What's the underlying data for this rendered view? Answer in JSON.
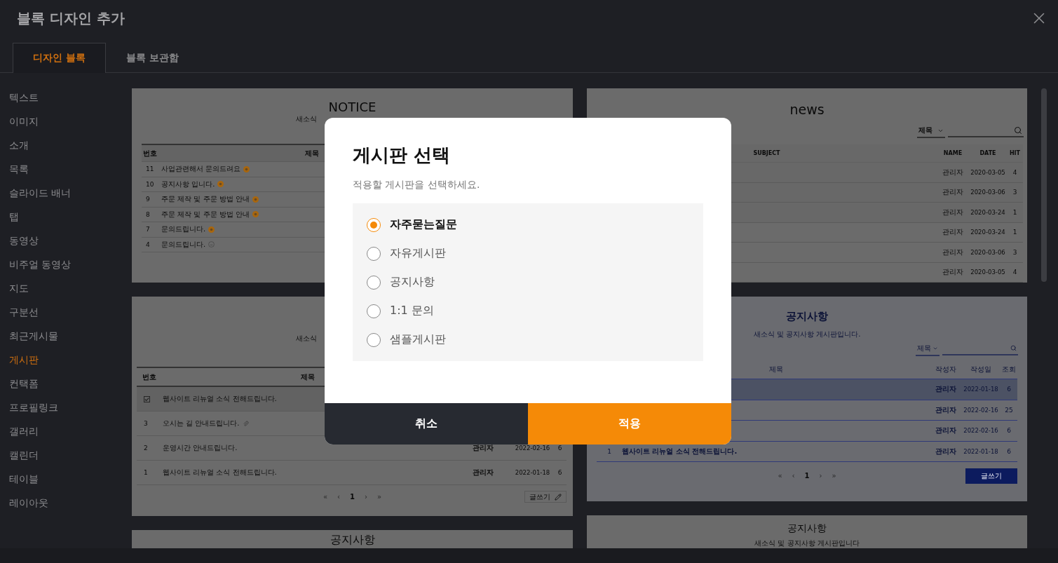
{
  "window": {
    "title": "블록 디자인 추가"
  },
  "tabs": [
    {
      "label": "디자인 블록",
      "selected": true
    },
    {
      "label": "블록 보관함",
      "selected": false
    }
  ],
  "sidebar": {
    "items": [
      {
        "label": "텍스트",
        "selected": false
      },
      {
        "label": "이미지",
        "selected": false
      },
      {
        "label": "소개",
        "selected": false
      },
      {
        "label": "목록",
        "selected": false
      },
      {
        "label": "슬라이드 배너",
        "selected": false
      },
      {
        "label": "탭",
        "selected": false
      },
      {
        "label": "동영상",
        "selected": false
      },
      {
        "label": "비주얼 동영상",
        "selected": false
      },
      {
        "label": "지도",
        "selected": false
      },
      {
        "label": "구분선",
        "selected": false
      },
      {
        "label": "최근게시물",
        "selected": false
      },
      {
        "label": "게시판",
        "selected": true
      },
      {
        "label": "컨택폼",
        "selected": false
      },
      {
        "label": "프로필링크",
        "selected": false
      },
      {
        "label": "갤러리",
        "selected": false
      },
      {
        "label": "캘린더",
        "selected": false
      },
      {
        "label": "테이블",
        "selected": false
      },
      {
        "label": "레이아웃",
        "selected": false
      }
    ]
  },
  "previews": [
    {
      "kind": "notice",
      "title": "NOTICE",
      "subtitle": "새소식",
      "columns": [
        "번호",
        "제목"
      ],
      "rows": [
        {
          "number": "11",
          "subject": "사업관련해서 문의드려요",
          "new": true
        },
        {
          "number": "10",
          "subject": "공지사항 입니다.",
          "new": true
        },
        {
          "number": "9",
          "subject": "주문 제작 및 주문 방법 안내",
          "new": true
        },
        {
          "number": "8",
          "subject": "주문 제작 및 주문 방법 안내",
          "new": true
        },
        {
          "number": "7",
          "subject": "문의드립니다.",
          "new": true
        },
        {
          "number": "4",
          "subject": "문의드립니다.",
          "new": false
        }
      ]
    },
    {
      "kind": "news",
      "title": "news",
      "filter": "제목",
      "columns": [
        "SUBJECT",
        "NAME",
        "DATE",
        "HIT"
      ],
      "rows": [
        {
          "name": "관리자",
          "date": "2020-03-05",
          "hit": "4"
        },
        {
          "name": "관리자",
          "date": "2020-03-06",
          "hit": "3"
        },
        {
          "name": "관리자",
          "date": "2020-03-24",
          "hit": "1"
        },
        {
          "name": "관리자",
          "date": "2020-03-24",
          "hit": "1"
        },
        {
          "name": "관리자",
          "date": "2020-03-06",
          "hit": "3"
        },
        {
          "name": "관리자",
          "date": "2020-03-05",
          "hit": "4"
        }
      ]
    },
    {
      "kind": "board",
      "subtitle": "새소식",
      "columns": [
        "번호",
        "제목"
      ],
      "rows": [
        {
          "pinned": true,
          "subject": "웹사이트 리뉴얼 소식 전해드립니다.",
          "attachment": false
        },
        {
          "pinned": false,
          "number": "3",
          "subject": "오시는 길 안내드립니다.",
          "attachment": true
        },
        {
          "pinned": false,
          "number": "2",
          "subject": "운영시간 안내드립니다.",
          "attachment": false,
          "name": "관리자",
          "date": "2022-02-16",
          "hit": "6"
        },
        {
          "pinned": false,
          "number": "1",
          "subject": "웹사이트 리뉴얼 소식 전해드립니다.",
          "attachment": false,
          "name": "관리자",
          "date": "2022-01-18",
          "hit": "6"
        }
      ],
      "pagination": [
        {
          "label": "«",
          "selected": false
        },
        {
          "label": "‹",
          "selected": false
        },
        {
          "label": "1",
          "selected": true
        },
        {
          "label": "›",
          "selected": false
        },
        {
          "label": "»",
          "selected": false
        }
      ],
      "write_button": "글쓰기"
    },
    {
      "kind": "navy_board",
      "title": "공지사항",
      "subtitle": "새소식 및 공지사항 게시판입니다.",
      "filter": "제목",
      "columns": [
        "제목",
        "작성자",
        "작성일",
        "조회"
      ],
      "rows": [
        {
          "highlighted": true,
          "name": "관리자",
          "date": "2022-01-18",
          "hit": "6"
        },
        {
          "highlighted": false,
          "name": "관리자",
          "date": "2022-02-16",
          "hit": "25"
        },
        {
          "highlighted": false,
          "name": "관리자",
          "date": "2022-02-16",
          "hit": "6"
        },
        {
          "highlighted": false,
          "number": "1",
          "subject": "웹사이트 리뉴얼 소식 전해드립니다.",
          "name": "관리자",
          "date": "2022-01-18",
          "hit": "6"
        }
      ],
      "pagination": [
        {
          "label": "«",
          "selected": false
        },
        {
          "label": "‹",
          "selected": false
        },
        {
          "label": "1",
          "selected": true
        },
        {
          "label": "›",
          "selected": false
        },
        {
          "label": "»",
          "selected": false
        }
      ],
      "write_button": "글쓰기"
    },
    {
      "kind": "heading",
      "title": "공지사항"
    },
    {
      "kind": "heading",
      "title": "공지사항",
      "subtitle": "새소식 및 공지사항 게시판입니다"
    }
  ],
  "modal": {
    "title": "게시판 선택",
    "subtitle": "적용할 게시판을 선택하세요.",
    "options": [
      {
        "label": "자주묻는질문",
        "selected": true
      },
      {
        "label": "자유게시판",
        "selected": false
      },
      {
        "label": "공지사항",
        "selected": false
      },
      {
        "label": "1:1 문의",
        "selected": false
      },
      {
        "label": "샘플게시판",
        "selected": false
      }
    ],
    "buttons": [
      {
        "label": "취소",
        "kind": "cancel"
      },
      {
        "label": "적용",
        "kind": "apply"
      }
    ]
  }
}
